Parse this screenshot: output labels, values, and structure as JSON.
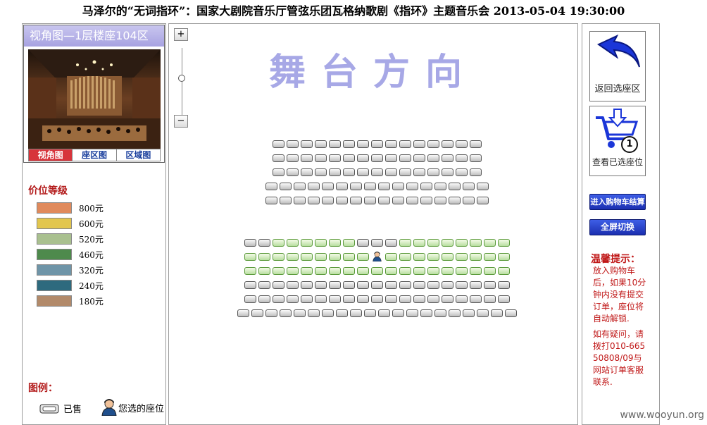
{
  "title": "马泽尔的“无词指环”：国家大剧院音乐厅管弦乐团瓦格纳歌剧《指环》主题音乐会 2013-05-04 19:30:00",
  "view": {
    "header": "视角图—1层楼座104区",
    "tabs": [
      "视角图",
      "座区图",
      "区域图"
    ],
    "active_tab": 0
  },
  "price": {
    "heading": "价位等级",
    "levels": [
      {
        "label": "800元",
        "color": "#e08a5c"
      },
      {
        "label": "600元",
        "color": "#e2c64e"
      },
      {
        "label": "520元",
        "color": "#a9c08f"
      },
      {
        "label": "460元",
        "color": "#4e8a4c"
      },
      {
        "label": "320元",
        "color": "#6f95a8"
      },
      {
        "label": "240元",
        "color": "#2e6a7e"
      },
      {
        "label": "180元",
        "color": "#b28a6a"
      }
    ]
  },
  "legend": {
    "heading": "图例：",
    "sold": "已售",
    "mine": "您选的座位"
  },
  "zoom": {
    "plus": "+",
    "minus": "−",
    "level": 0.45
  },
  "stage": "舞台方向",
  "seat_rows": [
    {
      "seats": "SSSSSSSSSSSSSSS"
    },
    {
      "seats": "SSSSSSSSSSSSSSS"
    },
    {
      "seats": "SSSSSSSSSSSSSSS"
    },
    {
      "seats": "SSSSSSSSSSSSSSSS"
    },
    {
      "seats": "SSSSSSSSSSSSSSSS"
    },
    {
      "seats": "SSAAAAAASSSAAAAAAAA"
    },
    {
      "seats": "AAAAAAAAAMAAAAAAAAA"
    },
    {
      "seats": "AAAAAAAAAAAAAAAAAAA"
    },
    {
      "seats": "SSSSSSSSSSSSSSSSSSS"
    },
    {
      "seats": "SSSSSSSSSSSSSSSSSSS"
    },
    {
      "seats": "SSSSSSSSSSSSSSSSSSSS"
    }
  ],
  "actions": {
    "back": "返回选座区",
    "view_selected": "查看已选座位",
    "cart_count": "1",
    "checkout": "进入购物车结算",
    "fullscreen": "全屏切换"
  },
  "tips": {
    "heading": "温馨提示：",
    "text1": "放入购物车后，如果10分钟内没有提交订单，座位将自动解锁.",
    "text2": "如有疑问，请拨打010-66550808/09与网站订单客服联系."
  },
  "watermark": "www.wooyun.org"
}
